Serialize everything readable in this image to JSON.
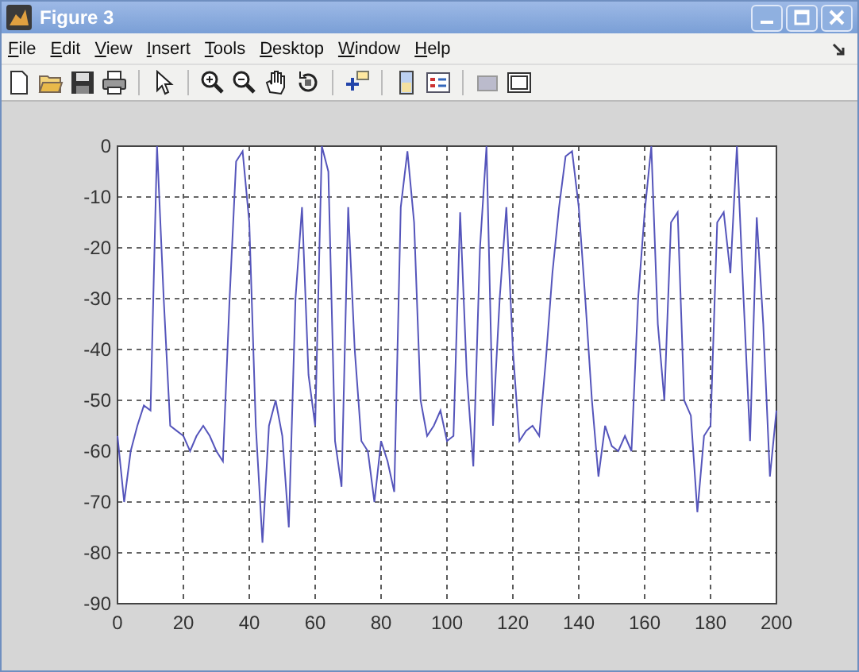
{
  "window": {
    "title": "Figure 3"
  },
  "menu": [
    {
      "label": "File"
    },
    {
      "label": "Edit"
    },
    {
      "label": "View"
    },
    {
      "label": "Insert"
    },
    {
      "label": "Tools"
    },
    {
      "label": "Desktop"
    },
    {
      "label": "Window"
    },
    {
      "label": "Help"
    }
  ],
  "toolbar": [
    {
      "kind": "new"
    },
    {
      "kind": "open"
    },
    {
      "kind": "save"
    },
    {
      "kind": "print"
    },
    {
      "kind": "sep"
    },
    {
      "kind": "pointer"
    },
    {
      "kind": "sep"
    },
    {
      "kind": "zoomin"
    },
    {
      "kind": "zoomout"
    },
    {
      "kind": "pan"
    },
    {
      "kind": "rotate"
    },
    {
      "kind": "sep"
    },
    {
      "kind": "datacursor"
    },
    {
      "kind": "sep"
    },
    {
      "kind": "colorbar"
    },
    {
      "kind": "legend"
    },
    {
      "kind": "sep"
    },
    {
      "kind": "hidetools"
    },
    {
      "kind": "showtools"
    }
  ],
  "chart_data": {
    "type": "line",
    "grid": true,
    "xlim": [
      0,
      200
    ],
    "ylim": [
      -90,
      0
    ],
    "xticks": [
      0,
      20,
      40,
      60,
      80,
      100,
      120,
      140,
      160,
      180,
      200
    ],
    "yticks": [
      0,
      -10,
      -20,
      -30,
      -40,
      -50,
      -60,
      -70,
      -80,
      -90
    ],
    "x": [
      0,
      2,
      4,
      6,
      8,
      10,
      12,
      14,
      16,
      18,
      20,
      22,
      24,
      26,
      28,
      30,
      32,
      34,
      36,
      38,
      40,
      42,
      44,
      46,
      48,
      50,
      52,
      54,
      56,
      58,
      60,
      62,
      64,
      66,
      68,
      70,
      72,
      74,
      76,
      78,
      80,
      82,
      84,
      86,
      88,
      90,
      92,
      94,
      96,
      98,
      100,
      102,
      104,
      106,
      108,
      110,
      112,
      114,
      116,
      118,
      120,
      122,
      124,
      126,
      128,
      130,
      132,
      134,
      136,
      138,
      140,
      142,
      144,
      146,
      148,
      150,
      152,
      154,
      156,
      158,
      160,
      162,
      164,
      166,
      168,
      170,
      172,
      174,
      176,
      178,
      180,
      182,
      184,
      186,
      188,
      190,
      192,
      194,
      196,
      198,
      200
    ],
    "series": [
      {
        "color": "#5555bb",
        "values": [
          -57,
          -70,
          -60,
          -55,
          -51,
          -52,
          0,
          -30,
          -55,
          -56,
          -57,
          -60,
          -57,
          -55,
          -57,
          -60,
          -62,
          -30,
          -3,
          -1,
          -15,
          -55,
          -78,
          -55,
          -50,
          -57,
          -75,
          -30,
          -12,
          -45,
          -55,
          0,
          -5,
          -58,
          -67,
          -12,
          -40,
          -58,
          -60,
          -70,
          -58,
          -62,
          -68,
          -12,
          -1,
          -15,
          -50,
          -57,
          -55,
          -52,
          -58,
          -57,
          -13,
          -45,
          -63,
          -20,
          0,
          -55,
          -30,
          -12,
          -40,
          -58,
          -56,
          -55,
          -57,
          -42,
          -25,
          -12,
          -2,
          -1,
          -12,
          -30,
          -50,
          -65,
          -55,
          -59,
          -60,
          -57,
          -60,
          -30,
          -13,
          0,
          -35,
          -50,
          -15,
          -13,
          -50,
          -53,
          -72,
          -57,
          -55,
          -15,
          -13,
          -25,
          0,
          -30,
          -58,
          -14,
          -35,
          -65,
          -52
        ]
      }
    ]
  }
}
